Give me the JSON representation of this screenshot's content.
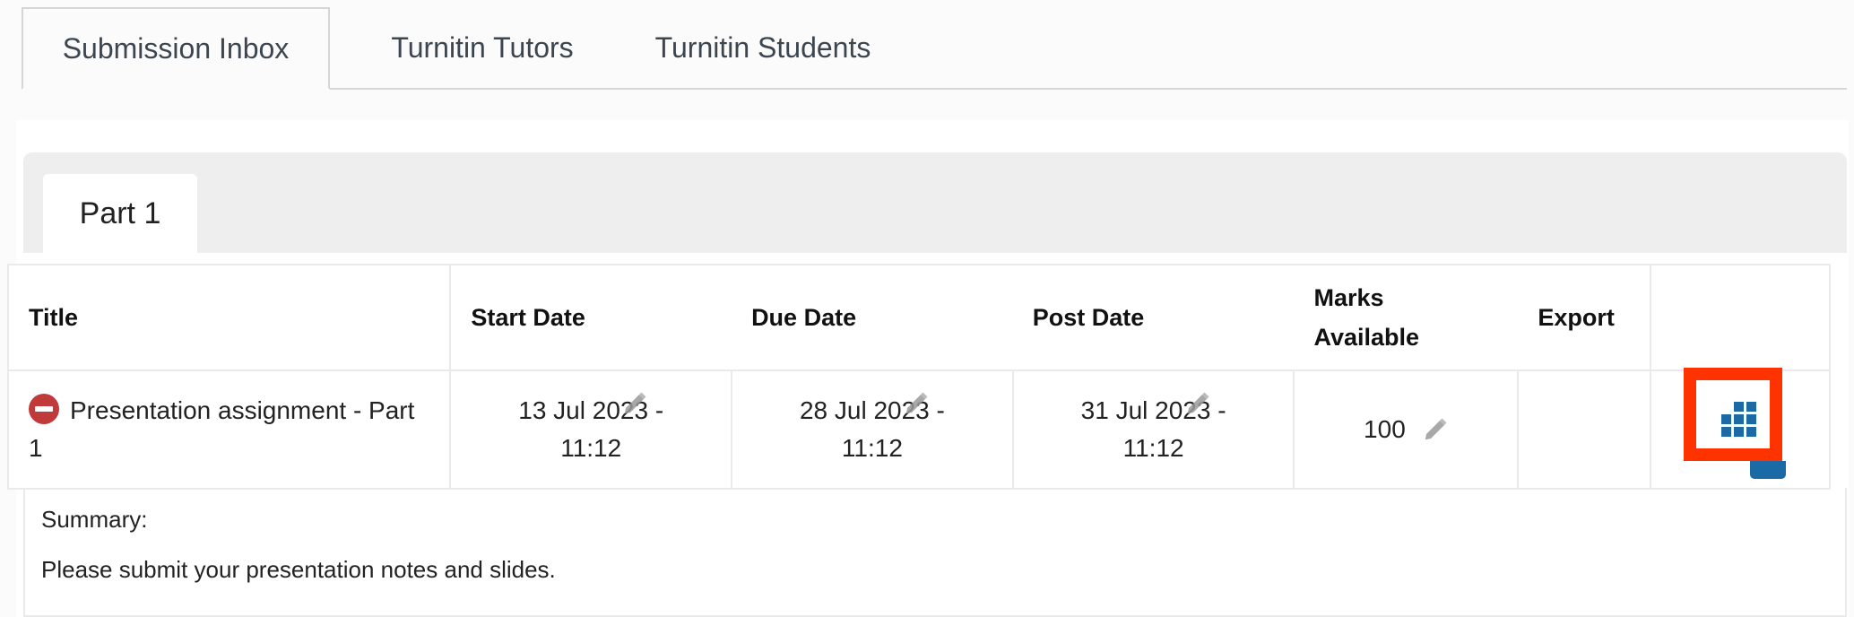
{
  "tabs": [
    {
      "label": "Submission Inbox",
      "active": true
    },
    {
      "label": "Turnitin Tutors",
      "active": false
    },
    {
      "label": "Turnitin Students",
      "active": false
    }
  ],
  "parts": [
    {
      "label": "Part 1",
      "active": true
    }
  ],
  "table": {
    "headers": {
      "title": "Title",
      "start_date": "Start Date",
      "due_date": "Due Date",
      "post_date": "Post Date",
      "marks_available": "Marks Available",
      "export": "Export"
    },
    "rows": [
      {
        "status_icon": "no-entry-icon",
        "title": "Presentation assignment - Part 1",
        "start_date": "13 Jul 2023 - 11:12",
        "due_date": "28 Jul 2023 - 11:12",
        "post_date": "31 Jul 2023 - 11:12",
        "marks_available": "100",
        "export": ""
      }
    ]
  },
  "summary": {
    "label": "Summary:",
    "text": "Please submit your presentation notes and slides."
  },
  "colors": {
    "highlight": "#ff3300",
    "icon_blue": "#1b6aa5",
    "status_red": "#c0393b"
  }
}
